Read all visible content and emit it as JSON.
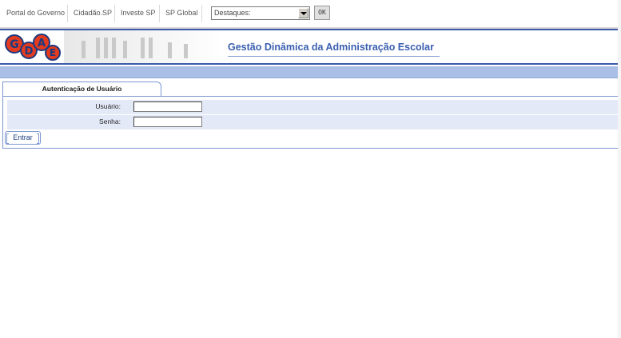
{
  "topbar": {
    "links": [
      "Portal do Governo",
      "Cidadão.SP",
      "Investe SP",
      "SP Global"
    ],
    "select_value": "Destaques:",
    "ok_label": "OK"
  },
  "header": {
    "logo_text": "GDAE",
    "title": "Gestão Dinâmica da Administração Escolar"
  },
  "login": {
    "tab_label": "Autenticação de Usuário",
    "user_label": "Usuário:",
    "user_value": "",
    "password_label": "Senha:",
    "password_value": "",
    "submit_label": "Entrar"
  },
  "colors": {
    "accent": "#3a5fb0",
    "bar": "#a9bfe6",
    "row": "#e4e9f7"
  }
}
